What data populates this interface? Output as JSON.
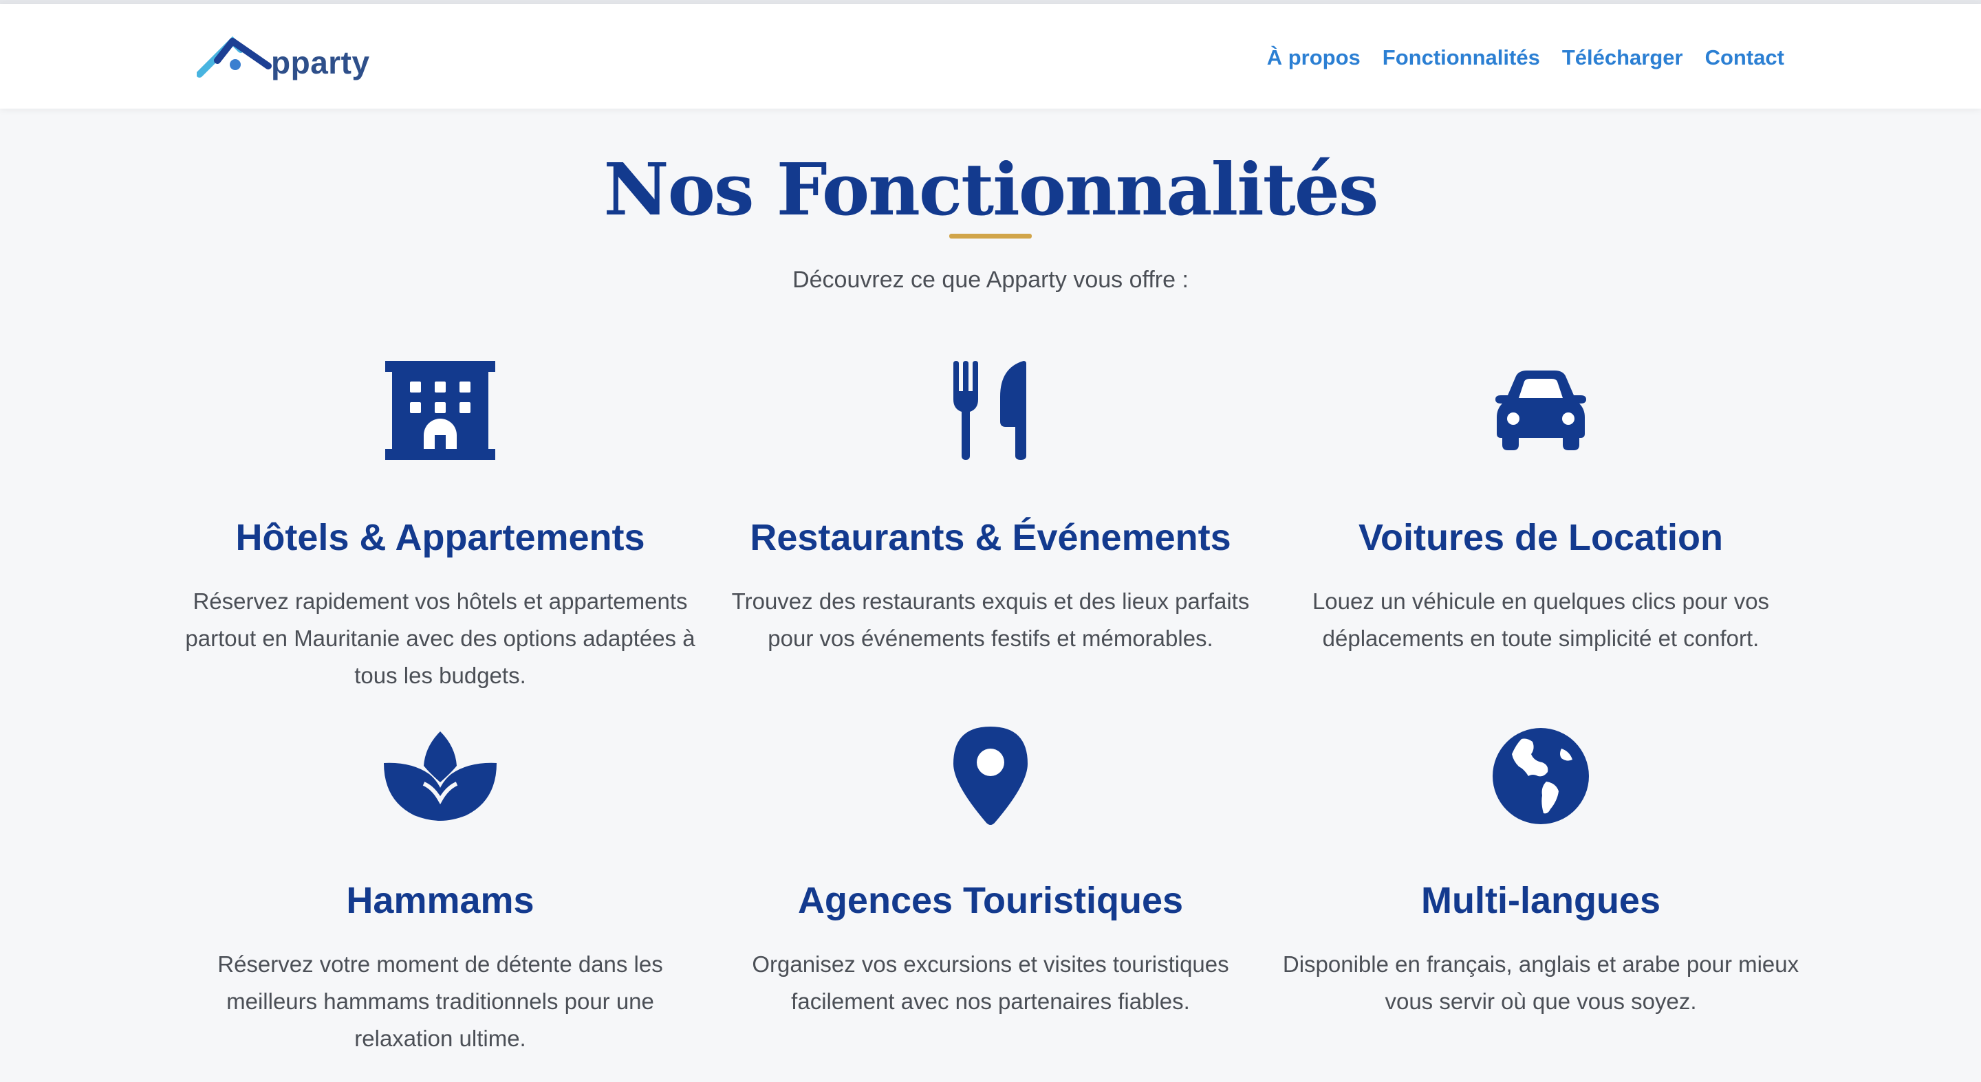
{
  "header": {
    "logo_text": "pparty",
    "logo_colors": {
      "house": "#1c3f94",
      "house_light": "#48b4e0",
      "dot": "#3a7fd0",
      "text": "#2e4f8a"
    },
    "nav": [
      {
        "label": "À propos"
      },
      {
        "label": "Fonctionnalités"
      },
      {
        "label": "Télécharger"
      },
      {
        "label": "Contact"
      }
    ],
    "nav_color": "#2b7fd3"
  },
  "main": {
    "title": "Nos Fonctionnalités",
    "subtitle": "Découvrez ce que Apparty vous offre :",
    "title_color": "#133a8e",
    "accent_color": "#d1a54a",
    "features": [
      {
        "icon": "hotel-icon",
        "title": "Hôtels & Appartements",
        "description": "Réservez rapidement vos hôtels et appartements partout en Mauritanie avec des options adaptées à tous les budgets."
      },
      {
        "icon": "utensils-icon",
        "title": "Restaurants & Événements",
        "description": "Trouvez des restaurants exquis et des lieux parfaits pour vos événements festifs et mémorables."
      },
      {
        "icon": "car-icon",
        "title": "Voitures de Location",
        "description": "Louez un véhicule en quelques clics pour vos déplacements en toute simplicité et confort."
      },
      {
        "icon": "lotus-spa-icon",
        "title": "Hammams",
        "description": "Réservez votre moment de détente dans les meilleurs hammams traditionnels pour une relaxation ultime."
      },
      {
        "icon": "location-pin-icon",
        "title": "Agences Touristiques",
        "description": "Organisez vos excursions et visites touristiques facilement avec nos partenaires fiables."
      },
      {
        "icon": "globe-icon",
        "title": "Multi-langues",
        "description": "Disponible en français, anglais et arabe pour mieux vous servir où que vous soyez."
      }
    ]
  }
}
